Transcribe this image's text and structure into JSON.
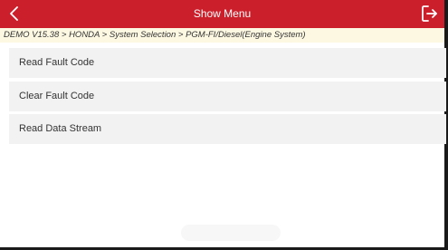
{
  "header": {
    "title": "Show Menu",
    "back_icon": "chevron-left-icon",
    "exit_icon": "exit-icon",
    "color": "#cc1f2c"
  },
  "breadcrumb": {
    "text": "DEMO V15.38 > HONDA > System Selection > PGM-FI/Diesel(Engine System)"
  },
  "menu": {
    "items": [
      {
        "label": "Read Fault Code"
      },
      {
        "label": "Clear Fault Code"
      },
      {
        "label": "Read Data Stream"
      }
    ]
  }
}
